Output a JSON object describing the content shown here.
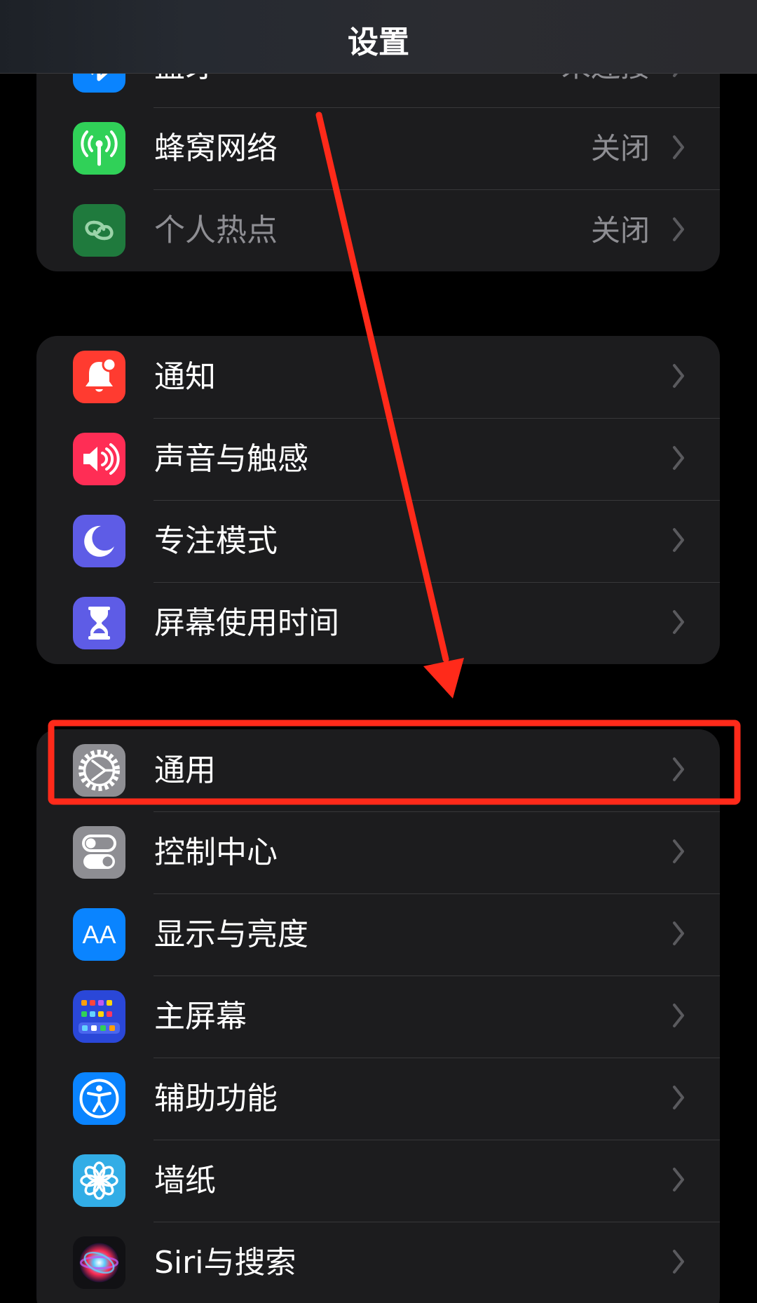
{
  "header": {
    "title": "设置"
  },
  "groups": [
    {
      "items": [
        {
          "label": "蓝牙",
          "value": "未连接"
        },
        {
          "label": "蜂窝网络",
          "value": "关闭"
        },
        {
          "label": "个人热点",
          "value": "关闭"
        }
      ]
    },
    {
      "items": [
        {
          "label": "通知"
        },
        {
          "label": "声音与触感"
        },
        {
          "label": "专注模式"
        },
        {
          "label": "屏幕使用时间"
        }
      ]
    },
    {
      "items": [
        {
          "label": "通用",
          "icon_text": ""
        },
        {
          "label": "控制中心"
        },
        {
          "label": "显示与亮度",
          "icon_text": "AA"
        },
        {
          "label": "主屏幕"
        },
        {
          "label": "辅助功能"
        },
        {
          "label": "墙纸"
        },
        {
          "label": "Siri与搜索"
        }
      ]
    }
  ],
  "colors": {
    "bluetooth": "#0a84ff",
    "cellular": "#30d158",
    "hotspot": "#1f7a3d",
    "notifications": "#ff3b30",
    "sounds": "#ff2d55",
    "focus": "#5e5ce6",
    "screen_time": "#5e5ce6",
    "general": "#8e8e93",
    "control_center": "#8e8e93",
    "display": "#0a84ff",
    "home_screen": "#2a47d8",
    "accessibility": "#0a84ff",
    "wallpaper": "#32ade6",
    "annotation": "#ff2a1a"
  },
  "icons": [
    "bluetooth-icon",
    "cellular-antenna-icon",
    "hotspot-link-icon",
    "bell-icon",
    "speaker-icon",
    "moon-icon",
    "hourglass-icon",
    "gear-icon",
    "toggle-icon",
    "text-size-icon",
    "app-grid-icon",
    "accessibility-person-icon",
    "flower-icon",
    "siri-orb-icon",
    "chevron-right-icon",
    "annotation-arrow-icon",
    "highlight-box"
  ]
}
